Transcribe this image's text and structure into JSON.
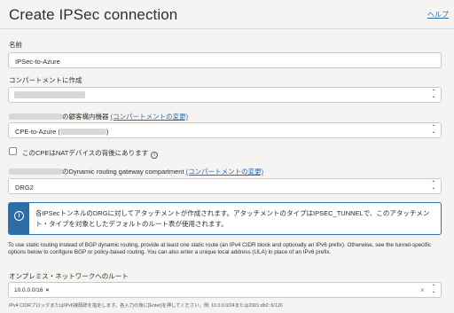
{
  "header": {
    "title": "Create IPSec connection",
    "help_link": "ヘルプ"
  },
  "name": {
    "label": "名前",
    "value": "IPSec-to-Azure"
  },
  "compartment": {
    "label": "コンパートメントに作成"
  },
  "cpe": {
    "label_suffix": "の顧客構内機器",
    "change_link": "(コンパートメントの変更)",
    "value_prefix": "CPE-to-Azure (",
    "value_suffix": ")",
    "nat_checkbox_label": "このCPEはNATデバイスの背後にあります",
    "nat_info_icon": "i"
  },
  "drg": {
    "label_suffix": "のDynamic routing gateway compartment",
    "change_link": "(コンパートメントの変更)",
    "value": "DRG2"
  },
  "info_banner": {
    "icon": "i",
    "text": "各IPSecトンネルのDRGに対してアタッチメントが作成されます。アタッチメントのタイプはIPSEC_TUNNELで、このアタッチメント・タイプを対象としたデフォルトのルート表が使用されます。"
  },
  "routing_note": "To use static routing instead of BGP dynamic routing, provide at least one static route (an IPv4 CIDR block and optionally an IPv6 prefix). Otherwise, see the tunnel-specific options below to configure BGP or policy-based routing. You can also enter a unique local address (ULA) in place of an IPv6 prefix.",
  "onprem_routes": {
    "label": "オンプレミス・ネットワークへのルート",
    "tags": [
      "10.0.0.0/16"
    ],
    "tag_remove": "×",
    "clear": "×",
    "hint": "IPv4 CIDRブロックまたはIPv6接頭辞を指定します。各入力の後に[Enter]を押してください。例: 10.0.0.0/24または2001:db2::6/126"
  },
  "icons": {
    "select_chevron": "chevron-up-down-icon",
    "info": "info-icon",
    "clear": "clear-icon"
  },
  "colors": {
    "accent": "#2e6da4",
    "link": "#2c6ba8",
    "background": "#f5f4f2"
  }
}
